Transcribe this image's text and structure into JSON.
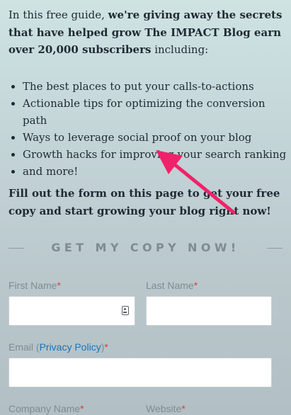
{
  "intro": {
    "prefix": "In this free guide, ",
    "bold": "we're giving away the secrets that have helped grow The IMPACT Blog earn over 20,000 subscribers",
    "suffix": " including:"
  },
  "bullets": [
    "The best places to put your calls-to-actions",
    "Actionable tips for optimizing the conversion path",
    "Ways to leverage social proof on your blog",
    "Growth hacks for improving your search ranking",
    "and more!"
  ],
  "cta_text": "Fill out the form on this page to get your free copy and start growing your blog right now!",
  "form": {
    "heading": "GET MY COPY NOW!",
    "required_mark": "*",
    "first_name": {
      "label": "First Name",
      "value": "",
      "placeholder": ""
    },
    "last_name": {
      "label": "Last Name",
      "value": "",
      "placeholder": ""
    },
    "email": {
      "label_prefix": "Email (",
      "link": "Privacy Policy",
      "label_suffix": ")",
      "value": "",
      "placeholder": ""
    },
    "company_name": {
      "label": "Company Name"
    },
    "website": {
      "label": "Website"
    }
  },
  "colors": {
    "annotation_arrow": "#f0226a",
    "required_star": "#e03a3a",
    "link": "#1a73b8"
  },
  "icons": [
    "autofill-contact-icon",
    "annotation-arrow"
  ]
}
